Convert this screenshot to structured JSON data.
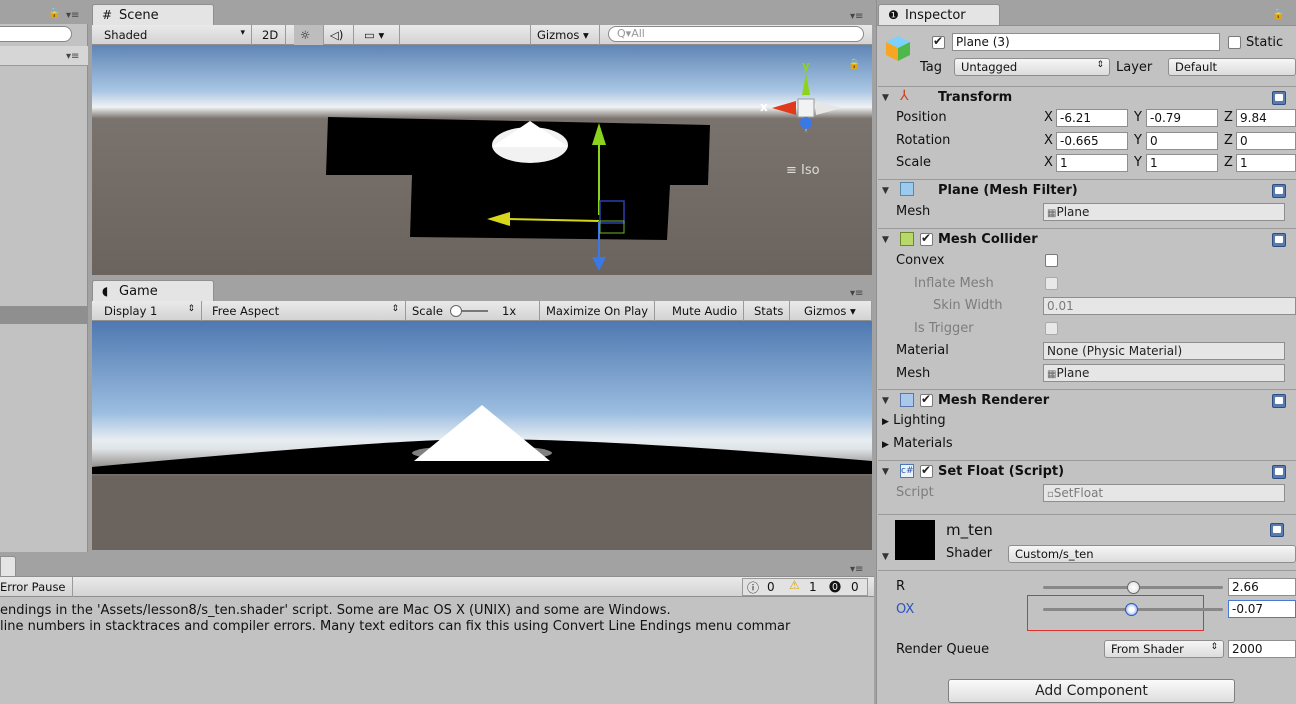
{
  "hierarchy": {
    "tab_label": ""
  },
  "scene": {
    "tab_label": "Scene",
    "shading": "Shaded",
    "mode_2d": "2D",
    "gizmos": "Gizmos",
    "search_placeholder": "All",
    "view_label": "Iso",
    "axis_x": "x",
    "axis_y": "y"
  },
  "game": {
    "tab_label": "Game",
    "display": "Display 1",
    "aspect": "Free Aspect",
    "scale_label": "Scale",
    "scale_value": "1x",
    "maximize": "Maximize On Play",
    "mute": "Mute Audio",
    "stats": "Stats",
    "gizmos": "Gizmos"
  },
  "console": {
    "error_pause": "Error Pause",
    "count_info": "0",
    "count_warn": "1",
    "count_error": "0",
    "line1": "endings in the 'Assets/lesson8/s_ten.shader' script. Some are Mac OS X (UNIX) and some are Windows.",
    "line2": " line numbers in stacktraces and compiler errors. Many text editors can fix this using Convert Line Endings menu commar"
  },
  "inspector": {
    "tab_label": "Inspector",
    "object_name": "Plane (3)",
    "static_label": "Static",
    "tag_label": "Tag",
    "tag_value": "Untagged",
    "layer_label": "Layer",
    "layer_value": "Default",
    "transform": {
      "title": "Transform",
      "position_label": "Position",
      "rotation_label": "Rotation",
      "scale_label": "Scale",
      "x": "X",
      "y": "Y",
      "z": "Z",
      "position": [
        "-6.21",
        "-0.79",
        "9.84"
      ],
      "rotation": [
        "-0.665",
        "0",
        "0"
      ],
      "scale": [
        "1",
        "1",
        "1"
      ]
    },
    "mesh_filter": {
      "title": "Plane (Mesh Filter)",
      "mesh_label": "Mesh",
      "mesh_value": "Plane"
    },
    "mesh_collider": {
      "title": "Mesh Collider",
      "convex": "Convex",
      "inflate": "Inflate Mesh",
      "skin_width_label": "Skin Width",
      "skin_width_value": "0.01",
      "is_trigger": "Is Trigger",
      "material_label": "Material",
      "material_value": "None (Physic Material)",
      "mesh_label": "Mesh",
      "mesh_value": "Plane"
    },
    "mesh_renderer": {
      "title": "Mesh Renderer",
      "lighting": "Lighting",
      "materials": "Materials"
    },
    "set_float": {
      "title": "Set Float (Script)",
      "script_label": "Script",
      "script_value": "SetFloat"
    },
    "material": {
      "name": "m_ten",
      "shader_label": "Shader",
      "shader_value": "Custom/s_ten",
      "r_label": "R",
      "r_value": "2.66",
      "r_fraction": 0.5,
      "ox_label": "OX",
      "ox_value": "-0.07",
      "ox_fraction": 0.49,
      "render_queue_label": "Render Queue",
      "render_queue_mode": "From Shader",
      "render_queue_value": "2000"
    },
    "add_component": "Add Component"
  },
  "colors": {
    "selection_box": "#e03030",
    "axis_x": "#e03a1a",
    "axis_y": "#8bd31d",
    "axis_z": "#3a78e6",
    "highlight_text": "#2a55c0"
  }
}
